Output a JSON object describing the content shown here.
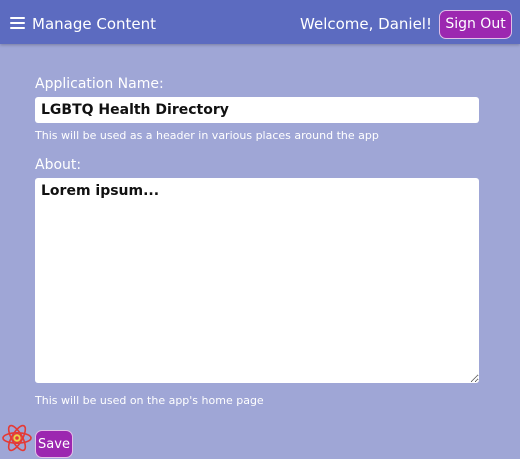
{
  "header": {
    "menu_icon": "hamburger-menu-icon",
    "title": "Manage Content",
    "welcome": "Welcome, Daniel!",
    "sign_out_label": "Sign Out"
  },
  "form": {
    "app_name": {
      "label": "Application Name:",
      "value": "LGBTQ Health Directory",
      "help": "This will be used as a header in various places around the app"
    },
    "about": {
      "label": "About:",
      "value": "Lorem ipsum...",
      "help": "This will be used on the app's home page"
    },
    "save_label": "Save"
  },
  "colors": {
    "header_bg": "#5c6bc0",
    "page_bg": "#9fa6d6",
    "button_bg": "#9c27b0",
    "logo_red": "#e53935"
  },
  "logo_icon": "react-atom-icon"
}
